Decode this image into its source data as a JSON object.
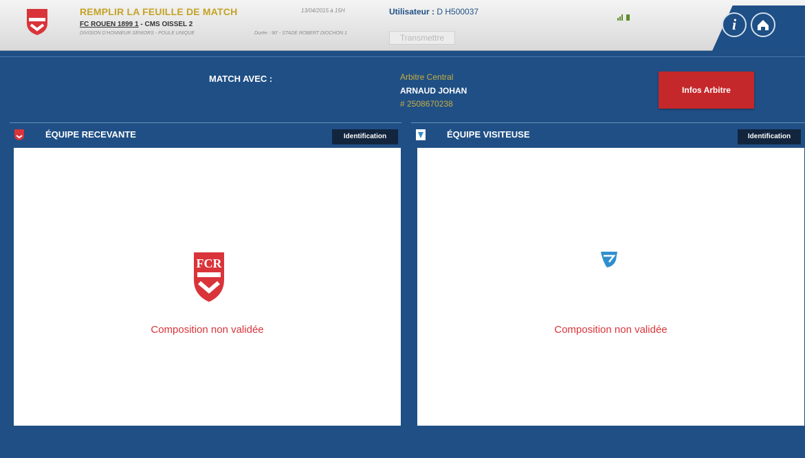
{
  "header": {
    "title": "REMPLIR LA FEUILLE DE MATCH",
    "home_team": "FC ROUEN 1899 1",
    "match_sep": " - ",
    "away_team": "CMS OISSEL 2",
    "division": "DIVISION D'HONNEUR SENIORS - POULE UNIQUE",
    "date": "13/04/2015 à 15H",
    "venue": "Durée : 90' - STADE ROBERT DIOCHON 1",
    "user_label": "Utilisateur : ",
    "user_id": "D H500037",
    "transmit_label": "Transmettre"
  },
  "match": {
    "avec_label": "MATCH AVEC :",
    "referee_role": "Arbitre Central",
    "referee_name": "ARNAUD JOHAN",
    "referee_number": "# 2508670238",
    "infos_button": "Infos Arbitre"
  },
  "teams": {
    "home": {
      "label": "ÉQUIPE RECEVANTE",
      "ident_button": "Identification",
      "status": "Composition non validée"
    },
    "away": {
      "label": "ÉQUIPE VISITEUSE",
      "ident_button": "Identification",
      "status": "Composition non validée"
    }
  },
  "nav": {
    "info_icon": "info-icon",
    "home_icon": "home-icon"
  },
  "colors": {
    "primary_blue": "#1f4f85",
    "accent_red": "#c5282b",
    "title_gold": "#c4a224",
    "status_red": "#d9343a"
  }
}
